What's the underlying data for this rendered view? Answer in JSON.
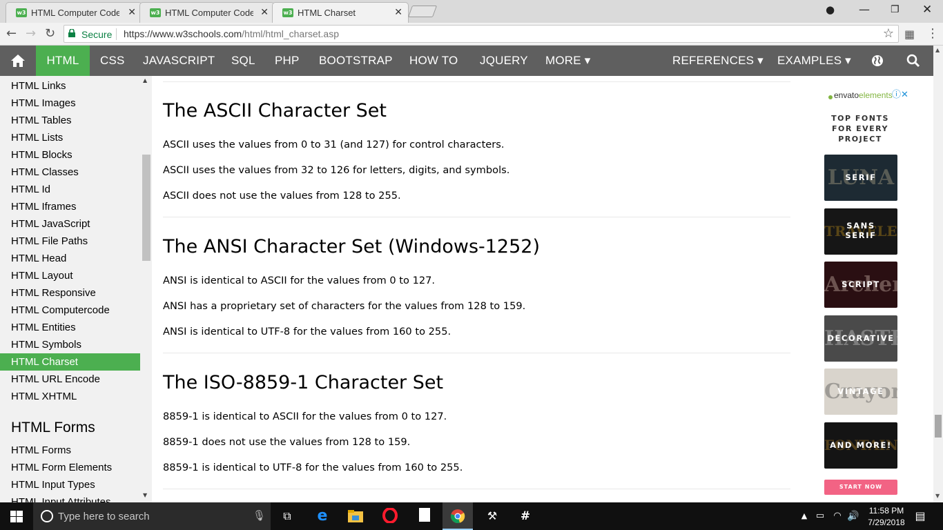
{
  "browser": {
    "tabs": [
      {
        "label": "HTML Computer Code Ele",
        "favicon": "w3"
      },
      {
        "label": "HTML Computer Code Ele",
        "favicon": "w3"
      },
      {
        "label": "HTML Charset",
        "favicon": "w3"
      }
    ],
    "secure_label": "Secure",
    "url_domain": "https://www.w3schools.com",
    "url_path": "/html/html_charset.asp"
  },
  "topnav": {
    "items": [
      "HTML",
      "CSS",
      "JAVASCRIPT",
      "SQL",
      "PHP",
      "BOOTSTRAP",
      "HOW TO",
      "JQUERY",
      "MORE ▾",
      "REFERENCES ▾",
      "EXAMPLES ▾"
    ],
    "active": "HTML",
    "accent": "#4caf50",
    "bar_color": "#5f5f5f"
  },
  "sidebar": {
    "links": [
      "HTML Links",
      "HTML Images",
      "HTML Tables",
      "HTML Lists",
      "HTML Blocks",
      "HTML Classes",
      "HTML Id",
      "HTML Iframes",
      "HTML JavaScript",
      "HTML File Paths",
      "HTML Head",
      "HTML Layout",
      "HTML Responsive",
      "HTML Computercode",
      "HTML Entities",
      "HTML Symbols",
      "HTML Charset",
      "HTML URL Encode",
      "HTML XHTML"
    ],
    "active": "HTML Charset",
    "heading": "HTML Forms",
    "forms_links": [
      "HTML Forms",
      "HTML Form Elements",
      "HTML Input Types",
      "HTML Input Attributes"
    ]
  },
  "main": {
    "sections": [
      {
        "heading": "The ASCII Character Set",
        "lines": [
          "ASCII uses the values from 0 to 31 (and 127) for control characters.",
          "ASCII uses the values from 32 to 126 for letters, digits, and symbols.",
          "ASCII does not use the values from 128 to 255."
        ]
      },
      {
        "heading": "The ANSI Character Set (Windows-1252)",
        "lines": [
          "ANSI is identical to ASCII for the values from 0 to 127.",
          "ANSI has a proprietary set of characters for the values from 128 to 159.",
          "ANSI is identical to UTF-8 for the values from 160 to 255."
        ]
      },
      {
        "heading": "The ISO-8859-1 Character Set",
        "lines": [
          "8859-1 is identical to ASCII for the values from 0 to 127.",
          "8859-1 does not use the values from 128 to 159.",
          "8859-1 is identical to UTF-8 for the values from 160 to 255."
        ]
      }
    ]
  },
  "ad": {
    "brand_prefix": "envato",
    "brand_suffix": "elements",
    "headline": "TOP FONTS FOR EVERY PROJECT",
    "tiles": [
      {
        "label": "SERIF",
        "bg_text": "LUNA",
        "bg": "#1d2a33",
        "fg": "#c9b995"
      },
      {
        "label": "SANS SERIF",
        "bg_text": "TRAVELER",
        "bg": "#161616",
        "fg": "#d6a01a"
      },
      {
        "label": "SCRIPT",
        "bg_text": "Archer",
        "bg": "#2a0f12",
        "fg": "#e6d3c4"
      },
      {
        "label": "DECORATIVE",
        "bg_text": "HASTE",
        "bg": "#4a4a4a",
        "fg": "#dcdcdc"
      },
      {
        "label": "VINTAGE",
        "bg_text": "Crayon",
        "bg": "#d9d4cc",
        "fg": "#333333"
      },
      {
        "label": "AND MORE!",
        "bg_text": "FONTAINE",
        "bg": "#141414",
        "fg": "#c6902a"
      }
    ],
    "cta": "START NOW",
    "cta_color": "#f26384"
  },
  "taskbar": {
    "search_placeholder": "Type here to search",
    "time": "11:58 PM",
    "date": "7/29/2018"
  }
}
